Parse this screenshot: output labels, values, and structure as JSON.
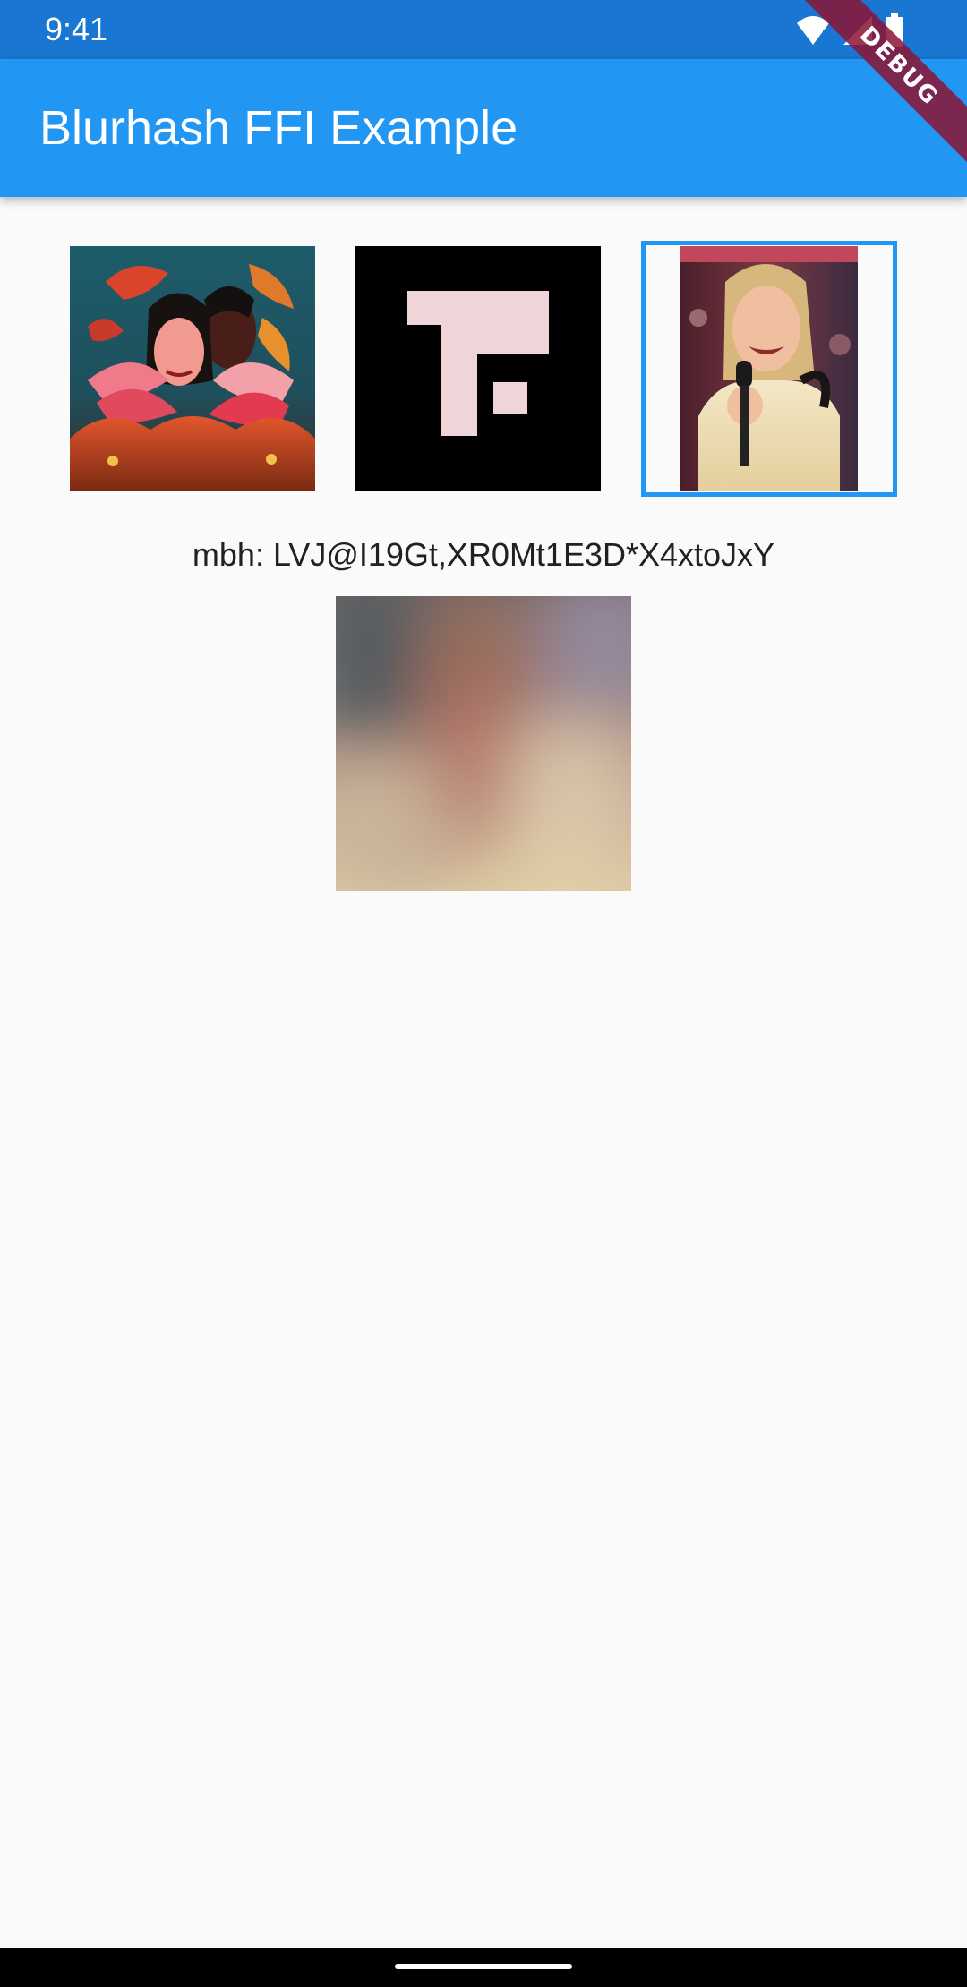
{
  "status_bar": {
    "time": "9:41",
    "icons": [
      "wifi-icon",
      "cell-signal-icon",
      "battery-icon"
    ]
  },
  "app_bar": {
    "title": "Blurhash FFI Example",
    "background": "#2196f3"
  },
  "debug_banner": {
    "label": "DEBUG"
  },
  "thumbnails": [
    {
      "name": "illustrated-portrait",
      "selected": false
    },
    {
      "name": "pixel-glyph",
      "selected": false
    },
    {
      "name": "woman-with-microphone",
      "selected": true
    }
  ],
  "hash": {
    "label": "mbh: LVJ@I19Gt,XR0Mt1E3D*X4xtoJxY"
  },
  "colors": {
    "status_bar": "#1976d2",
    "accent": "#2196f3",
    "background": "#fafafa"
  }
}
